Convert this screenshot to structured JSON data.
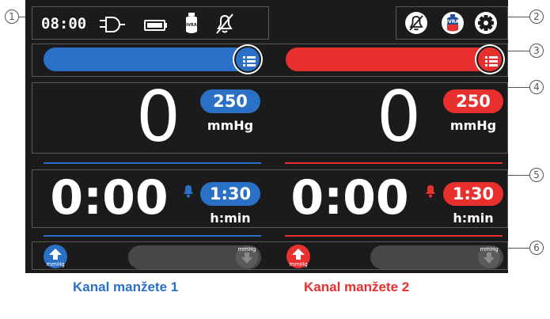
{
  "status": {
    "time": "08:00",
    "icons": [
      "plug-icon",
      "battery-icon",
      "ivra-icon",
      "alarm-muted-icon"
    ],
    "right_icons": [
      "alarm-muted-icon",
      "ivra-icon",
      "gear-icon"
    ],
    "ivra_label": "IVRA"
  },
  "callouts": [
    "1",
    "2",
    "3",
    "4",
    "5",
    "6"
  ],
  "channel1": {
    "color": "#2a70c6",
    "pressure": "0",
    "pressure_setpoint": "250",
    "pressure_unit": "mmHg",
    "time": "0:00",
    "time_setpoint": "1:30",
    "time_unit": "h:min",
    "inflate_unit": "mmHg",
    "deflate_unit": "mmHg",
    "caption": "Kanal manžete 1"
  },
  "channel2": {
    "color": "#e8302f",
    "pressure": "0",
    "pressure_setpoint": "250",
    "pressure_unit": "mmHg",
    "time": "0:00",
    "time_setpoint": "1:30",
    "time_unit": "h:min",
    "inflate_unit": "mmHg",
    "deflate_unit": "mmHg",
    "caption": "Kanal manžete 2"
  }
}
